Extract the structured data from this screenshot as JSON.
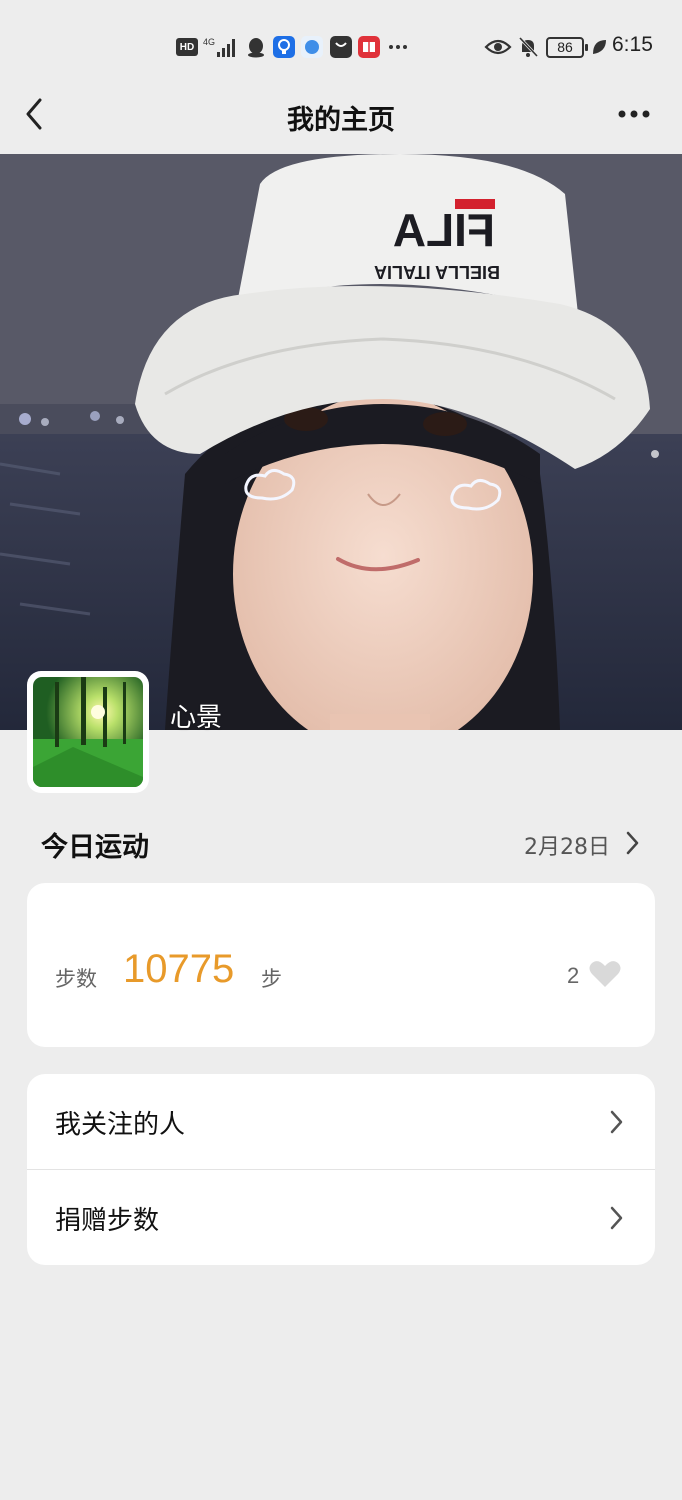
{
  "status_bar": {
    "hd": "HD",
    "signal": "4G",
    "battery": "86",
    "time": "6:15",
    "icons": [
      "hd-icon",
      "signal-icon",
      "qq-icon",
      "bulb-app-icon",
      "browser-app-icon",
      "bag-app-icon",
      "book-app-icon",
      "more-notifications-icon",
      "eye-icon",
      "bell-off-icon",
      "battery-icon",
      "leaf-icon"
    ]
  },
  "nav": {
    "title": "我的主页"
  },
  "profile": {
    "nickname": "心景"
  },
  "today": {
    "title": "今日运动",
    "date": "2月28日",
    "steps_label": "步数",
    "steps_value": "10775",
    "steps_unit": "步",
    "likes": "2"
  },
  "menu": [
    {
      "label": "我关注的人"
    },
    {
      "label": "捐赠步数"
    }
  ],
  "colors": {
    "background": "#ededed",
    "card": "#ffffff",
    "steps_accent": "#e89a2a"
  }
}
